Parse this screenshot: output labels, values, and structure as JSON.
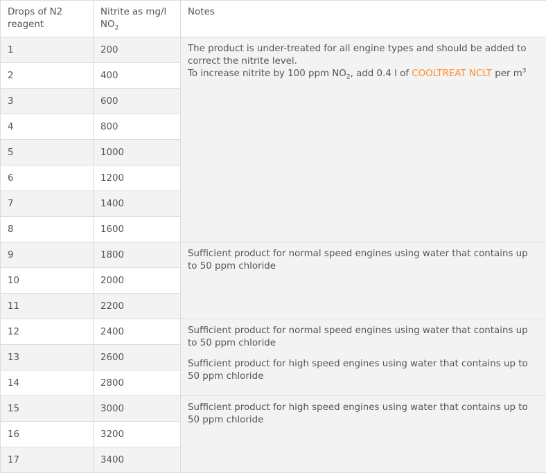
{
  "headers": {
    "drops": "Drops of N2 reagent",
    "nitrite_main": "Nitrite as mg/l",
    "nitrite_unit": "NO",
    "nitrite_unit_sub": "2",
    "notes": "Notes"
  },
  "rows": [
    {
      "drops": "1",
      "nitrite": "200"
    },
    {
      "drops": "2",
      "nitrite": "400"
    },
    {
      "drops": "3",
      "nitrite": "600"
    },
    {
      "drops": "4",
      "nitrite": "800"
    },
    {
      "drops": "5",
      "nitrite": "1000"
    },
    {
      "drops": "6",
      "nitrite": "1200"
    },
    {
      "drops": "7",
      "nitrite": "1400"
    },
    {
      "drops": "8",
      "nitrite": "1600"
    },
    {
      "drops": "9",
      "nitrite": "1800"
    },
    {
      "drops": "10",
      "nitrite": "2000"
    },
    {
      "drops": "11",
      "nitrite": "2200"
    },
    {
      "drops": "12",
      "nitrite": "2400"
    },
    {
      "drops": "13",
      "nitrite": "2600"
    },
    {
      "drops": "14",
      "nitrite": "2800"
    },
    {
      "drops": "15",
      "nitrite": "3000"
    },
    {
      "drops": "16",
      "nitrite": "3200"
    },
    {
      "drops": "17",
      "nitrite": "3400"
    }
  ],
  "notes": {
    "group1": {
      "line1": "The product is under-treated for all engine types and should be added to correct the nitrite level.",
      "line2_pre": "To increase nitrite by 100 ppm NO",
      "line2_sub": "2",
      "line2_mid": ", add 0.4 l of ",
      "line2_link": "COOLTREAT NCLT",
      "line2_post": " per m",
      "line2_sup": "3"
    },
    "group2": "Sufficient product for normal speed engines using water that contains up to 50 ppm chloride",
    "group3_a": "Sufficient product for normal speed engines using water that contains up to 50 ppm chloride",
    "group3_b": "Sufficient product for high speed engines using water that contains up to 50 ppm chloride",
    "group4": "Sufficient product for high speed engines using water that contains up to 50 ppm chloride"
  },
  "colors": {
    "link": "#ff8b2e",
    "text": "#555555",
    "stripe": "#f3f3f3",
    "border": "#dcdcdc"
  }
}
